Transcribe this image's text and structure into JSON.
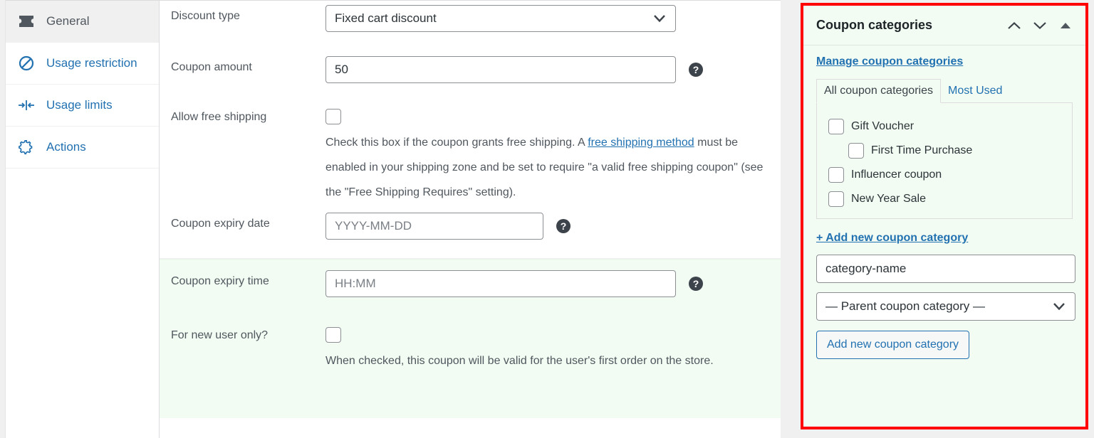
{
  "sidebar": {
    "items": [
      {
        "label": "General",
        "icon": "ticket-icon",
        "active": true
      },
      {
        "label": "Usage restriction",
        "icon": "prohibit-icon",
        "active": false
      },
      {
        "label": "Usage limits",
        "icon": "arrows-in-icon",
        "active": false
      },
      {
        "label": "Actions",
        "icon": "gear-icon",
        "active": false
      }
    ]
  },
  "form": {
    "discount_type": {
      "label": "Discount type",
      "value": "Fixed cart discount"
    },
    "coupon_amount": {
      "label": "Coupon amount",
      "value": "50",
      "help": "?"
    },
    "allow_free_shipping": {
      "label": "Allow free shipping",
      "checked": false,
      "desc_before": "Check this box if the coupon grants free shipping. A ",
      "desc_link": "free shipping method",
      "desc_after": " must be enabled in your shipping zone and be set to require \"a valid free shipping coupon\" (see the \"Free Shipping Requires\" setting)."
    },
    "coupon_expiry_date": {
      "label": "Coupon expiry date",
      "value": "",
      "placeholder": "YYYY-MM-DD",
      "help": "?"
    },
    "coupon_expiry_time": {
      "label": "Coupon expiry time",
      "value": "",
      "placeholder": "HH:MM",
      "help": "?"
    },
    "for_new_user_only": {
      "label": "For new user only?",
      "checked": false,
      "desc": "When checked, this coupon will be valid for the user's first order on the store."
    }
  },
  "meta_panel": {
    "title": "Coupon categories",
    "manage_link": "Manage coupon categories",
    "tabs": [
      {
        "label": "All coupon categories",
        "active": true
      },
      {
        "label": "Most Used",
        "active": false
      }
    ],
    "categories": [
      {
        "label": "Gift Voucher",
        "checked": false,
        "child": false
      },
      {
        "label": "First Time Purchase",
        "checked": false,
        "child": true
      },
      {
        "label": "Influencer coupon",
        "checked": false,
        "child": false
      },
      {
        "label": "New Year Sale",
        "checked": false,
        "child": false
      }
    ],
    "add_new_link": "+ Add new coupon category",
    "new_category_name": "category-name",
    "parent_select_value": "— Parent coupon category —",
    "add_button": "Add new coupon category",
    "highlight_color": "#ff0000",
    "panel_background": "#f2fcf2"
  }
}
